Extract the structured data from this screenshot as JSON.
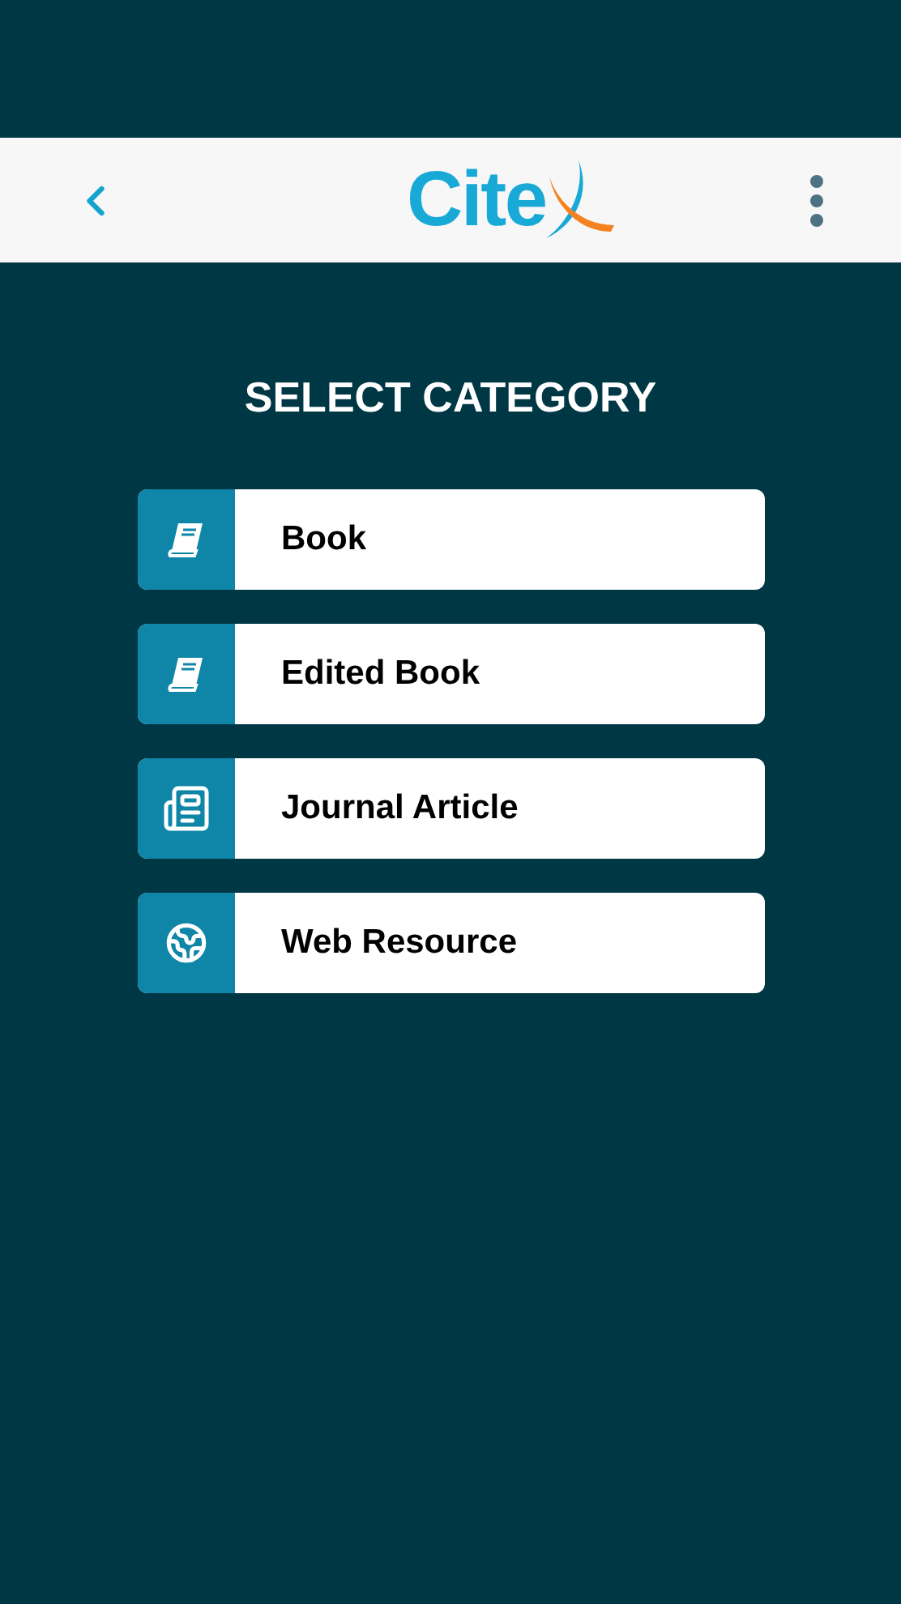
{
  "header": {
    "logo_text": "Cite"
  },
  "title": "SELECT CATEGORY",
  "categories": [
    {
      "label": "Book",
      "kind": "book"
    },
    {
      "label": "Edited Book",
      "kind": "book"
    },
    {
      "label": "Journal Article",
      "kind": "newspaper"
    },
    {
      "label": "Web Resource",
      "kind": "globe"
    }
  ]
}
